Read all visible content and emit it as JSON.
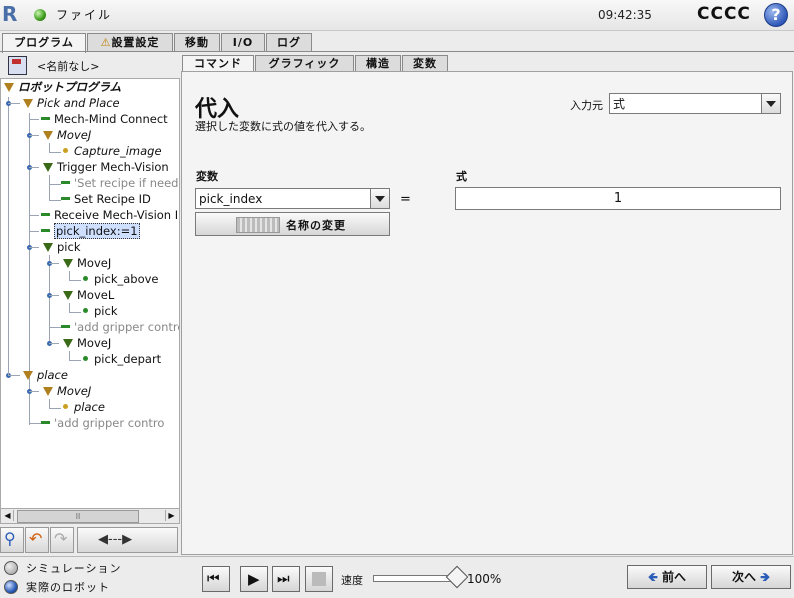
{
  "topbar": {
    "file_label": "ファイル",
    "clock": "09:42:35",
    "robot_name": "CCCC",
    "help_glyph": "?",
    "logo_glyph": "R"
  },
  "main_tabs": [
    {
      "label": "プログラム",
      "active": true
    },
    {
      "label": "設置設定",
      "icon": "warning-icon"
    },
    {
      "label": "移動"
    },
    {
      "label": "I/O"
    },
    {
      "label": "ログ"
    }
  ],
  "program": {
    "name": "<名前なし>"
  },
  "tree": [
    {
      "label": "ロボットプログラム"
    },
    {
      "label": "Pick and Place"
    },
    {
      "label": "Mech-Mind Connect"
    },
    {
      "label": "MoveJ"
    },
    {
      "label": "Capture_image"
    },
    {
      "label": "Trigger Mech-Vision"
    },
    {
      "label": "'Set recipe if neede"
    },
    {
      "label": "Set Recipe ID"
    },
    {
      "label": "Receive Mech-Vision I"
    },
    {
      "label": "pick_index:=1"
    },
    {
      "label": "pick"
    },
    {
      "label": "MoveJ"
    },
    {
      "label": "pick_above"
    },
    {
      "label": "MoveL"
    },
    {
      "label": "pick"
    },
    {
      "label": "'add gripper contro"
    },
    {
      "label": "MoveJ"
    },
    {
      "label": "pick_depart"
    },
    {
      "label": "place"
    },
    {
      "label": "MoveJ"
    },
    {
      "label": "place"
    },
    {
      "label": "'add gripper contro"
    }
  ],
  "scroll_thumb": "ll",
  "right_tabs": [
    {
      "label": "コマンド",
      "active": true
    },
    {
      "label": "グラフィック"
    },
    {
      "label": "構造"
    },
    {
      "label": "変数"
    }
  ],
  "assign": {
    "title": "代入",
    "description": "選択した変数に式の値を代入する。",
    "input_source_label": "入力元",
    "input_source_value": "式",
    "variable_label": "変数",
    "expression_label": "式",
    "variable_value": "pick_index",
    "equals": "=",
    "expression_value": "1",
    "rename_label": "名称の変更"
  },
  "bottom": {
    "simulation_label": "シミュレーション",
    "real_robot_label": "実際のロボット",
    "speed_label": "速度",
    "speed_value": "100%",
    "speed_fraction": 1.0,
    "prev_label": "前へ",
    "next_label": "次へ"
  },
  "colors": {
    "selected_row": "#cfe0ff",
    "accent_blue": "#2a5cb8",
    "status_green": "#3a9a1a"
  }
}
